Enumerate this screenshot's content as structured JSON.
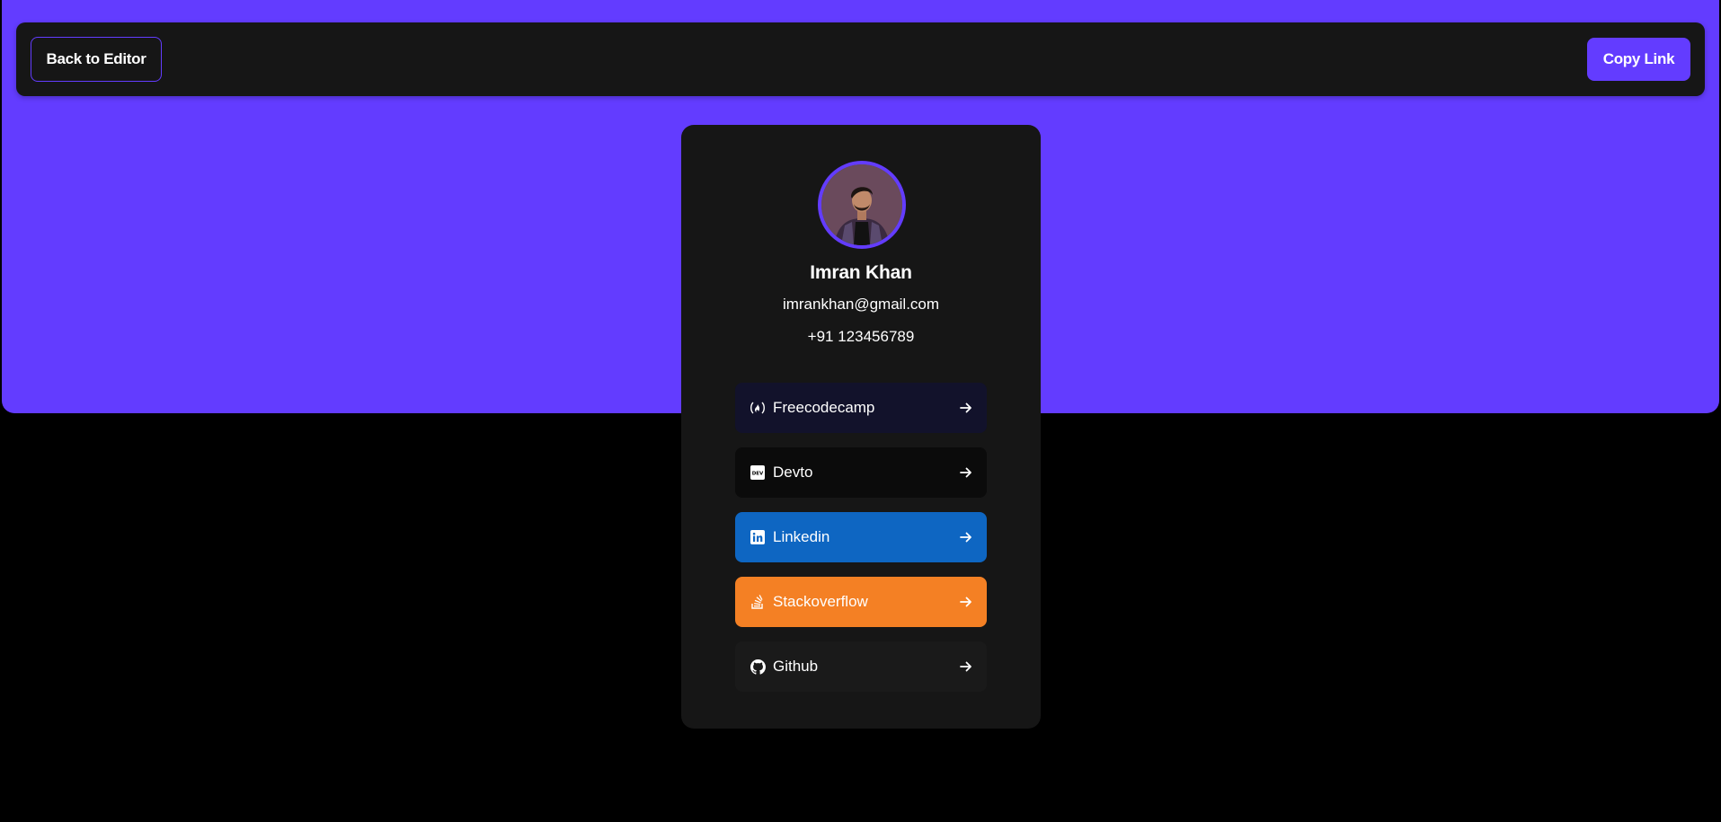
{
  "header": {
    "back_label": "Back to Editor",
    "copy_label": "Copy Link"
  },
  "profile": {
    "name": "Imran Khan",
    "email": "imrankhan@gmail.com",
    "phone": "+91 123456789"
  },
  "links": [
    {
      "label": "Freecodecamp",
      "icon": "freecodecamp-icon",
      "bg": "#12122b"
    },
    {
      "label": "Devto",
      "icon": "devto-icon",
      "bg": "#0b0b0b"
    },
    {
      "label": "Linkedin",
      "icon": "linkedin-icon",
      "bg": "#0e66c2"
    },
    {
      "label": "Stackoverflow",
      "icon": "stackoverflow-icon",
      "bg": "#f48024"
    },
    {
      "label": "Github",
      "icon": "github-icon",
      "bg": "#1a1a1a"
    }
  ],
  "colors": {
    "accent": "#633cff",
    "page_bg": "#000000",
    "card_bg": "#161616"
  }
}
